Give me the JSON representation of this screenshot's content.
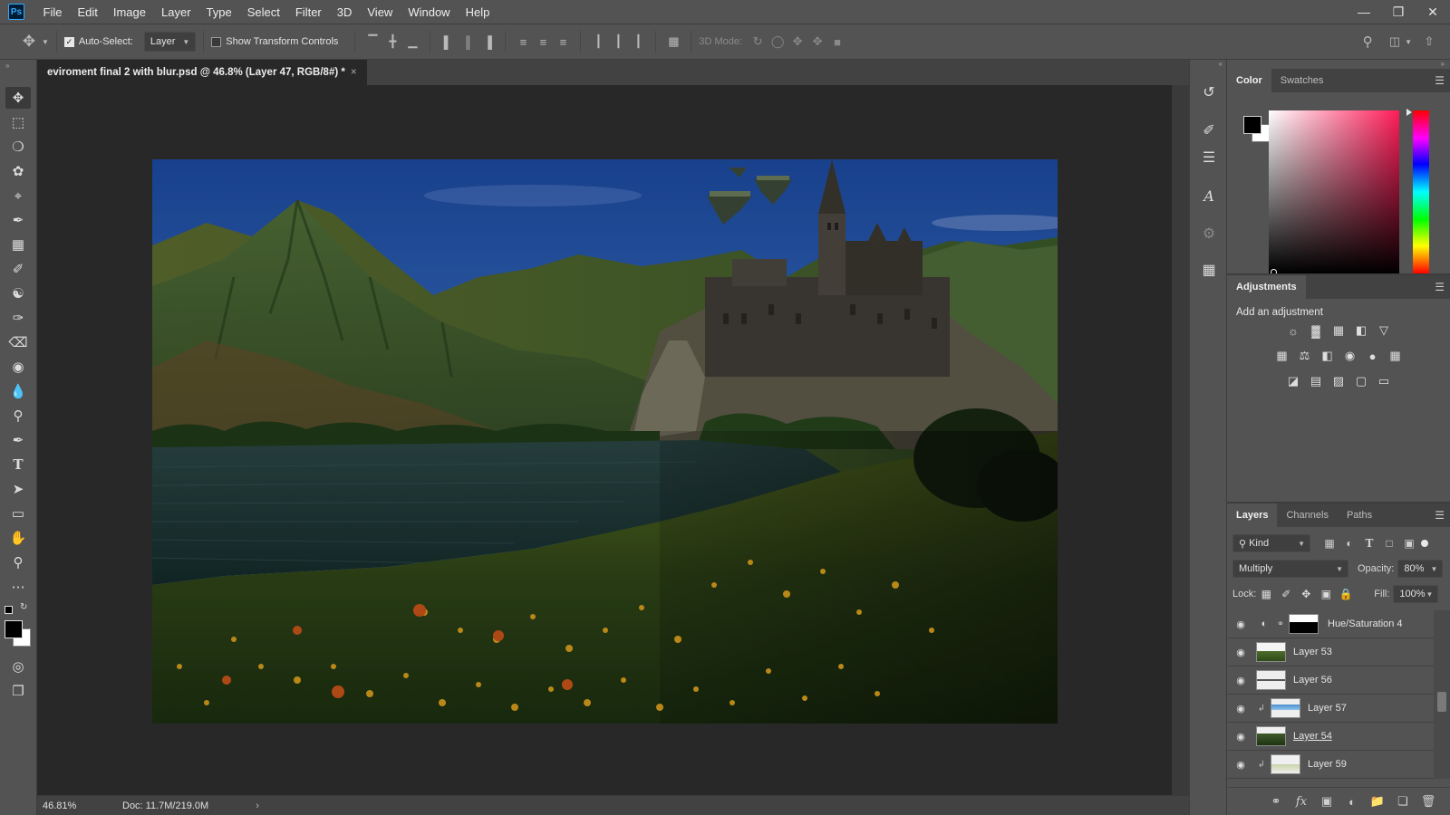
{
  "app": {
    "logo": "Ps",
    "menu": [
      "File",
      "Edit",
      "Image",
      "Layer",
      "Type",
      "Select",
      "Filter",
      "3D",
      "View",
      "Window",
      "Help"
    ],
    "window_controls": [
      "minimize-icon",
      "restore-icon",
      "close-icon"
    ]
  },
  "options": {
    "auto_select_label": "Auto-Select:",
    "auto_select_checked": true,
    "auto_select_target": "Layer",
    "transform_controls_label": "Show Transform Controls",
    "transform_controls_checked": false,
    "mode_3d_label": "3D Mode:"
  },
  "document": {
    "tab_title": "eviroment final 2 with blur.psd @ 46.8% (Layer 47, RGB/8#) *",
    "close_symbol": "×"
  },
  "status": {
    "zoom": "46.81%",
    "doc_size": "Doc: 11.7M/219.0M",
    "arrow": "›"
  },
  "color_panel": {
    "tabs": [
      "Color",
      "Swatches"
    ],
    "active_tab": "Color",
    "foreground": "#000000",
    "background": "#ffffff",
    "hue_accent": "#ff1d58"
  },
  "adjustments_panel": {
    "tab": "Adjustments",
    "title": "Add an adjustment"
  },
  "layers_panel": {
    "tabs": [
      "Layers",
      "Channels",
      "Paths"
    ],
    "active_tab": "Layers",
    "filter_kind": "Kind",
    "blend_mode": "Multiply",
    "opacity_label": "Opacity:",
    "opacity": "80%",
    "lock_label": "Lock:",
    "fill_label": "Fill:",
    "fill": "100%",
    "layers": [
      {
        "name": "Hue/Saturation 4",
        "visible": true,
        "type": "adjustment"
      },
      {
        "name": "Layer 53",
        "visible": true,
        "type": "pixel"
      },
      {
        "name": "Layer 56",
        "visible": true,
        "type": "pixel"
      },
      {
        "name": "Layer 57",
        "visible": true,
        "type": "clipped"
      },
      {
        "name": "Layer 54",
        "visible": true,
        "type": "pixel",
        "underlined": true
      },
      {
        "name": "Layer 59",
        "visible": true,
        "type": "clipped"
      }
    ]
  },
  "image": {
    "description_colors": {
      "sky": "#2f5fa8",
      "mountain": "#3e5a2c",
      "water": "#1f3b3c",
      "meadow": "#35501e",
      "flowers": "#d49b1d"
    }
  }
}
